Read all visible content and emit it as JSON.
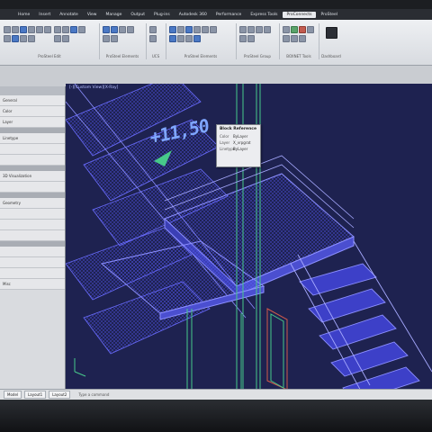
{
  "ribbon": {
    "tabs": [
      {
        "label": "Home"
      },
      {
        "label": "Insert"
      },
      {
        "label": "Annotate"
      },
      {
        "label": "View"
      },
      {
        "label": "Manage"
      },
      {
        "label": "Output"
      },
      {
        "label": "Plug-ins"
      },
      {
        "label": "Autodesk 360"
      },
      {
        "label": "Performance"
      },
      {
        "label": "Express Tools"
      },
      {
        "label": "ProConnects",
        "active": true
      },
      {
        "label": "ProSteel"
      }
    ],
    "panels": [
      {
        "title": "ProSteel Edit"
      },
      {
        "title": "ProSteel Elements"
      },
      {
        "title": "UCS"
      },
      {
        "title": "ProSteel Elements"
      },
      {
        "title": "ProSteel Group"
      },
      {
        "title": "BOXNET Tools"
      },
      {
        "title": "Dashboard"
      }
    ]
  },
  "palette": {
    "rows": [
      "General",
      "Color",
      "Layer",
      "",
      "Linetype",
      "",
      "",
      "3D Visualization",
      "",
      "Geometry",
      "",
      "",
      "",
      "",
      "",
      "",
      "",
      "Misc"
    ]
  },
  "viewport": {
    "label": "[-][Custom View][X-Ray]",
    "elevation_text": "+11,50"
  },
  "tooltip": {
    "title": "Block Reference",
    "rows": [
      {
        "key": "Color",
        "value": "ByLayer"
      },
      {
        "key": "Layer",
        "value": "X_vrpgrat"
      },
      {
        "key": "Linetype",
        "value": "ByLayer"
      }
    ]
  },
  "statusbar": {
    "buttons": [
      "Model",
      "Layout1",
      "Layout2"
    ],
    "command_placeholder": "Type a command"
  },
  "colors": {
    "wire_blue": "#5a5cff",
    "wire_light": "#8c8fff",
    "wire_green": "#47c98a",
    "wire_red": "#d05a4a",
    "background": "#1e2250"
  }
}
